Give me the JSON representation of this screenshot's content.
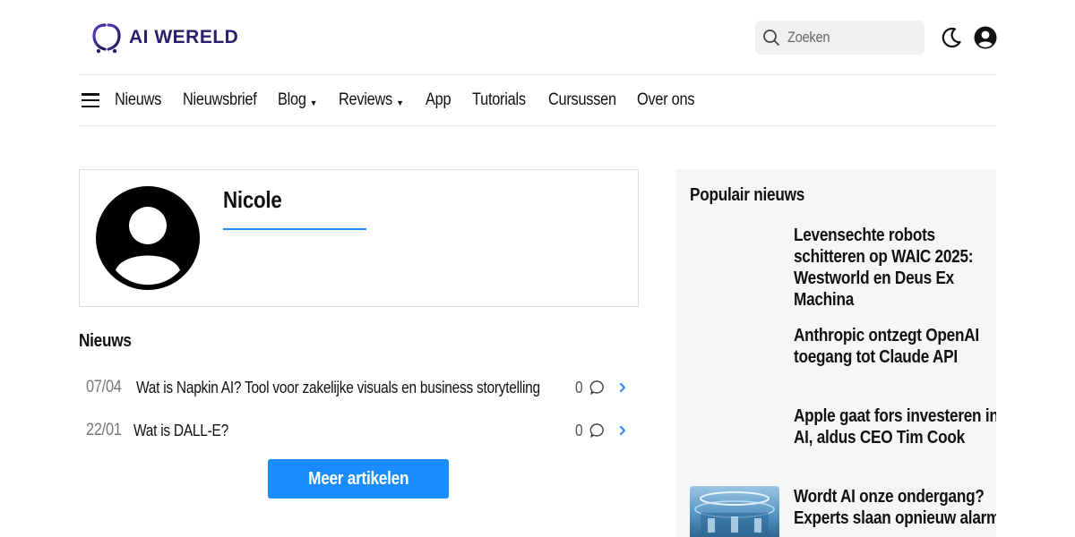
{
  "header": {
    "logo_text": "AI WERELD",
    "search_placeholder": "Zoeken"
  },
  "nav": {
    "items": [
      {
        "label": "Nieuws",
        "dropdown": false
      },
      {
        "label": "Nieuwsbrief",
        "dropdown": false
      },
      {
        "label": "Blog",
        "dropdown": true
      },
      {
        "label": "Reviews",
        "dropdown": true
      },
      {
        "label": "App",
        "dropdown": false
      },
      {
        "label": "Tutorials",
        "dropdown": false
      },
      {
        "label": "Cursussen",
        "dropdown": false
      },
      {
        "label": "Over ons",
        "dropdown": false
      }
    ],
    "caret": "▼"
  },
  "author": {
    "name": "Nicole"
  },
  "news": {
    "title": "Nieuws",
    "rows": [
      {
        "date": "07/04",
        "title": "Wat is Napkin AI? Tool voor zakelijke visuals en business storytelling",
        "comments": "0"
      },
      {
        "date": "22/01",
        "title": "Wat is DALL-E?",
        "comments": "0"
      }
    ],
    "more_label": "Meer artikelen"
  },
  "sidebar": {
    "title": "Populair nieuws",
    "items": [
      {
        "title": "Levensechte robots schitteren op WAIC 2025: Westworld en Deus Ex Machina",
        "has_image": false
      },
      {
        "title": "Anthropic ontzegt OpenAI toegang tot Claude API",
        "has_image": false
      },
      {
        "title": "Apple gaat fors investeren in AI, aldus CEO Tim Cook",
        "has_image": false
      },
      {
        "title": "Wordt AI onze ondergang? Experts slaan opnieuw alarm",
        "has_image": true
      }
    ]
  },
  "colors": {
    "accent": "#1a8cff",
    "logo": "#2a1f6b",
    "sidebar_bg": "#f5f6f8"
  }
}
